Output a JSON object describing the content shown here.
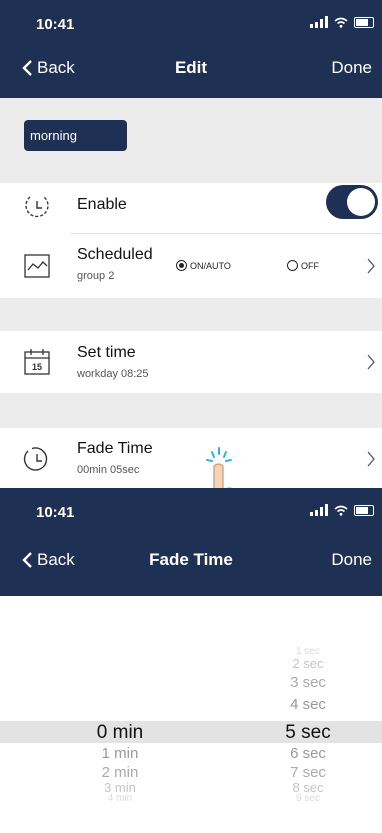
{
  "top": {
    "status": {
      "time": "10:41"
    },
    "nav": {
      "back": "Back",
      "title": "Edit",
      "done": "Done"
    },
    "tag": "morning",
    "enable": {
      "label": "Enable",
      "on": true
    },
    "scheduled": {
      "title": "Scheduled",
      "sub": "group 2",
      "opt_on": "ON/AUTO",
      "opt_off": "OFF",
      "selected": "ON/AUTO"
    },
    "set_time": {
      "title": "Set time",
      "sub": "workday 08:25"
    },
    "fade_time": {
      "title": "Fade Time",
      "sub": "00min 05sec"
    }
  },
  "bottom": {
    "status": {
      "time": "10:41"
    },
    "nav": {
      "back": "Back",
      "title": "Fade Time",
      "done": "Done"
    },
    "picker": {
      "minutes": [
        "0 min",
        "1 min",
        "2 min",
        "3 min",
        "4 min"
      ],
      "seconds": [
        "1 sec",
        "2 sec",
        "3 sec",
        "4 sec",
        "5 sec",
        "6 sec",
        "7 sec",
        "8 sec",
        "9 sec"
      ],
      "selected_minute": "0 min",
      "selected_second": "5 sec"
    }
  },
  "colors": {
    "navy": "#1e3155",
    "gap": "#ececec",
    "selection": "#e3e3e3"
  }
}
